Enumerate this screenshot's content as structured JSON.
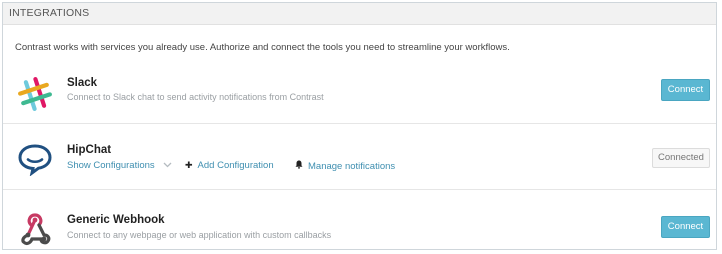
{
  "header": {
    "title": "INTEGRATIONS"
  },
  "intro": "Contrast works with services you already use. Authorize and connect the tools you need to streamline your workflows.",
  "integrations": [
    {
      "name": "Slack",
      "description": "Connect to Slack chat to send activity notifications from Contrast",
      "button": "Connect",
      "icon": "slack-logo"
    },
    {
      "name": "HipChat",
      "status_button": "Connected",
      "icon": "hipchat-logo",
      "actions": {
        "show_configurations": "Show Configurations",
        "add_configuration": "Add Configuration",
        "manage_notifications": "Manage notifications"
      }
    },
    {
      "name": "Generic Webhook",
      "description": "Connect to any webpage or web application with custom callbacks",
      "button": "Connect",
      "icon": "webhook-logo"
    }
  ],
  "colors": {
    "accent": "#5ab7d2",
    "link": "#3f8fb0",
    "hipchat": "#205081",
    "webhook_red": "#c73a63",
    "webhook_dark": "#4b4b4b"
  }
}
